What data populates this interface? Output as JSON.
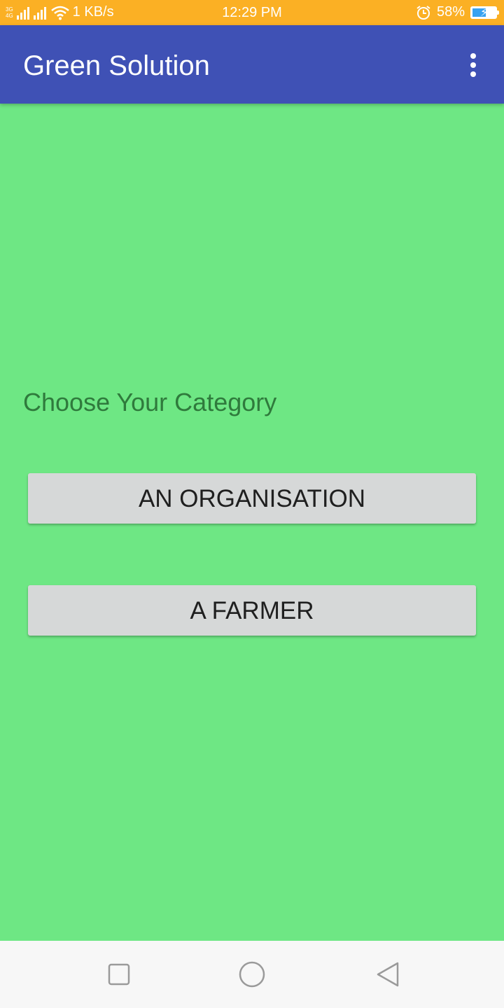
{
  "status_bar": {
    "net_top": "3G",
    "net_bottom": "4G",
    "speed": "1 KB/s",
    "time": "12:29 PM",
    "battery": "58%",
    "battery_level": 0.58
  },
  "app_bar": {
    "title": "Green Solution",
    "menu_icon": "more-vert-icon"
  },
  "main": {
    "prompt": "Choose Your Category",
    "buttons": [
      {
        "label": "AN ORGANISATION"
      },
      {
        "label": "A FARMER"
      }
    ]
  },
  "nav_bar": {
    "recent_icon": "square-icon",
    "home_icon": "circle-icon",
    "back_icon": "triangle-back-icon"
  },
  "colors": {
    "status_bar": "#fbb024",
    "app_bar": "#3f51b5",
    "background": "#6ee784",
    "prompt_text": "#2f7a3c",
    "button": "#d6d8d8"
  }
}
